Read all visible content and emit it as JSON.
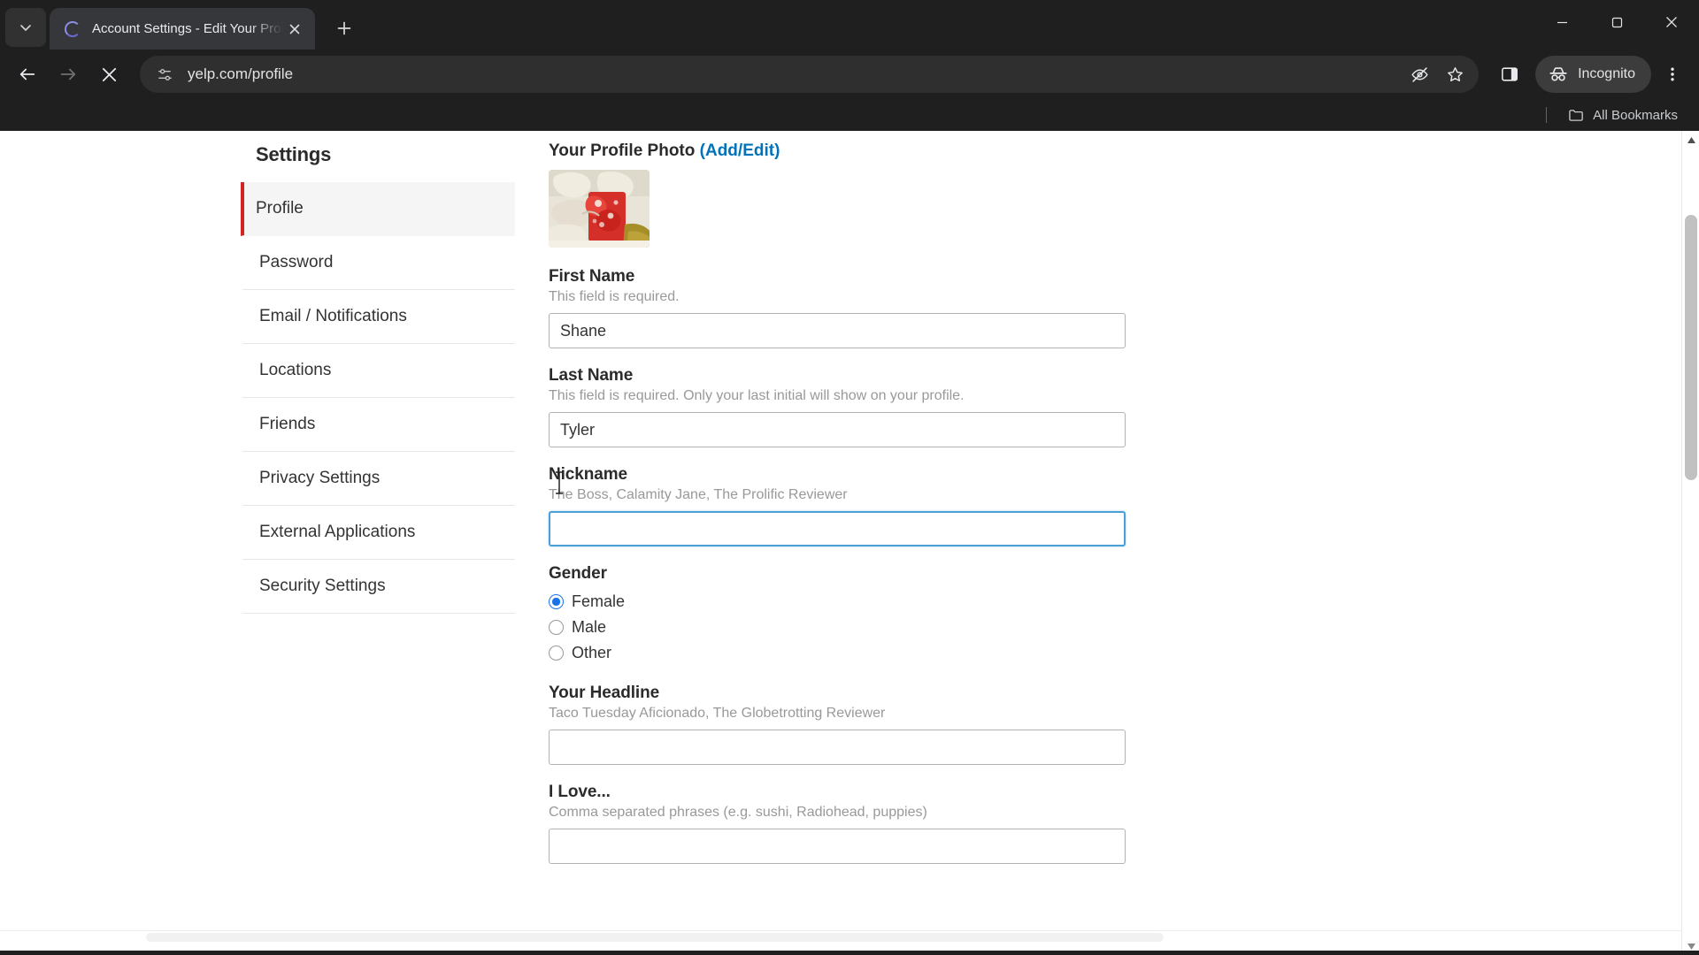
{
  "browser": {
    "tab": {
      "title": "Account Settings - Edit Your Prof",
      "favicon_name": "loading-spinner"
    },
    "new_tab_label": "+",
    "omnibox": {
      "url": "yelp.com/profile",
      "site_settings_icon": "tune-icon"
    },
    "incognito_label": "Incognito",
    "bookmarks": {
      "all_bookmarks_label": "All Bookmarks"
    },
    "window_controls": {
      "minimize": "minimize",
      "maximize": "maximize",
      "close": "close"
    }
  },
  "page": {
    "sidebar": {
      "title": "Settings",
      "items": [
        {
          "label": "Profile",
          "active": true
        },
        {
          "label": "Password",
          "active": false
        },
        {
          "label": "Email / Notifications",
          "active": false
        },
        {
          "label": "Locations",
          "active": false
        },
        {
          "label": "Friends",
          "active": false
        },
        {
          "label": "Privacy Settings",
          "active": false
        },
        {
          "label": "External Applications",
          "active": false
        },
        {
          "label": "Security Settings",
          "active": false
        }
      ]
    },
    "profile_photo": {
      "label": "Your Profile Photo",
      "edit_link": "(Add/Edit)"
    },
    "fields": {
      "first_name": {
        "label": "First Name",
        "help": "This field is required.",
        "value": "Shane",
        "placeholder": ""
      },
      "last_name": {
        "label": "Last Name",
        "help": "This field is required. Only your last initial will show on your profile.",
        "value": "Tyler",
        "placeholder": ""
      },
      "nickname": {
        "label": "Nickname",
        "help": "The Boss, Calamity Jane, The Prolific Reviewer",
        "value": "",
        "placeholder": ""
      },
      "gender": {
        "label": "Gender",
        "options": [
          {
            "label": "Female",
            "selected": true
          },
          {
            "label": "Male",
            "selected": false
          },
          {
            "label": "Other",
            "selected": false
          }
        ]
      },
      "headline": {
        "label": "Your Headline",
        "help": "Taco Tuesday Aficionado, The Globetrotting Reviewer",
        "value": "",
        "placeholder": ""
      },
      "i_love": {
        "label": "I Love...",
        "help": "Comma separated phrases (e.g. sushi, Radiohead, puppies)",
        "value": "",
        "placeholder": ""
      }
    }
  },
  "colors": {
    "accent_red": "#d32323",
    "link_blue": "#0073bb",
    "focus_blue": "#4c9fd6",
    "radio_blue": "#1b73e8",
    "chrome_dark": "#1f1f1f"
  }
}
